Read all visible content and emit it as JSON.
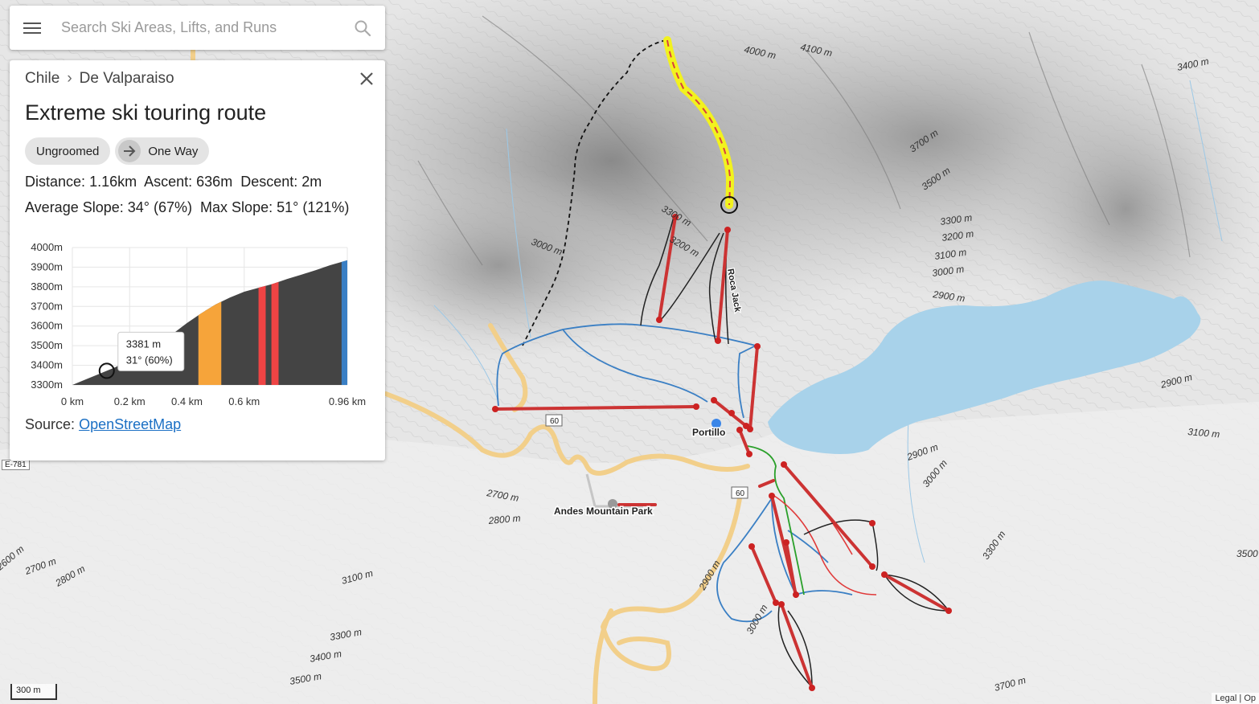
{
  "search": {
    "placeholder": "Search Ski Areas, Lifts, and Runs"
  },
  "icons": {
    "menu": "hamburger-menu-icon",
    "search": "search-icon",
    "close": "close-icon",
    "direction": "arrow-right-icon"
  },
  "panel": {
    "breadcrumb": [
      "Chile",
      "De Valparaiso"
    ],
    "breadcrumb_separator": "›",
    "title": "Extreme ski touring route",
    "badges": {
      "grooming": "Ungroomed",
      "direction": "One Way"
    },
    "stats": {
      "distance_label": "Distance:",
      "distance": "1.16km",
      "ascent_label": "Ascent:",
      "ascent": "636m",
      "descent_label": "Descent:",
      "descent": "2m",
      "avg_slope_label": "Average Slope:",
      "avg_slope": "34° (67%)",
      "max_slope_label": "Max Slope:",
      "max_slope": "51° (121%)"
    },
    "source_label": "Source:",
    "source_link": "OpenStreetMap"
  },
  "chart_data": {
    "type": "area",
    "title": "",
    "xlabel": "",
    "ylabel": "",
    "x_ticks": [
      "0 km",
      "0.2 km",
      "0.4 km",
      "0.6 km",
      "0.96 km"
    ],
    "x_tick_values": [
      0,
      0.2,
      0.4,
      0.6,
      0.96
    ],
    "y_ticks": [
      "3300m",
      "3400m",
      "3500m",
      "3600m",
      "3700m",
      "3800m",
      "3900m",
      "4000m"
    ],
    "y_tick_values": [
      3300,
      3400,
      3500,
      3600,
      3700,
      3800,
      3900,
      4000
    ],
    "xlim": [
      0,
      0.96
    ],
    "ylim": [
      3300,
      4000
    ],
    "x": [
      0,
      0.05,
      0.1,
      0.15,
      0.2,
      0.25,
      0.3,
      0.35,
      0.4,
      0.45,
      0.5,
      0.55,
      0.6,
      0.65,
      0.7,
      0.75,
      0.8,
      0.85,
      0.9,
      0.96
    ],
    "y": [
      3300,
      3330,
      3360,
      3390,
      3430,
      3470,
      3515,
      3560,
      3615,
      3665,
      3710,
      3745,
      3775,
      3795,
      3815,
      3840,
      3862,
      3885,
      3910,
      3935
    ],
    "fill_color": "#444444",
    "highlights": [
      {
        "from": 0.44,
        "to": 0.52,
        "color": "#f6a43a"
      },
      {
        "from": 0.65,
        "to": 0.675,
        "color": "#ee4444"
      },
      {
        "from": 0.695,
        "to": 0.72,
        "color": "#ee4444"
      },
      {
        "from": 0.94,
        "to": 0.96,
        "color": "#3a7fc4"
      }
    ],
    "tooltip": {
      "x": 0.12,
      "elevation": "3381 m",
      "slope": "31° (60%)"
    }
  },
  "map": {
    "contour_labels": [
      "4000 m",
      "4100 m",
      "3400 m",
      "3700 m",
      "3500 m",
      "3300 m",
      "3200 m",
      "3100 m",
      "3000 m",
      "2900 m",
      "3300 m",
      "3200 m",
      "3000 m",
      "2900 m",
      "3100 m",
      "2900 m",
      "3000 m",
      "3300 m",
      "3500",
      "2700 m",
      "2800 m",
      "2900 m",
      "3000 m",
      "3100 m",
      "3300 m",
      "3400 m",
      "3500 m",
      "3700 m",
      "2700 m",
      "2800 m",
      "2600 m"
    ],
    "places": {
      "portillo": "Portillo",
      "andes_park": "Andes Mountain Park"
    },
    "lift_label": "Roca Jack",
    "road_shields": [
      "60",
      "60"
    ],
    "road_e781": "E-781",
    "lake_color": "#a8d2ea",
    "route_highlight_color": "#f2f21e",
    "lift_color": "#cc3333",
    "advanced_run_color": "#e03a3a",
    "intermediate_run_color": "#3a7fc4",
    "easy_run_color": "#2aa02a",
    "expert_run_color": "#222222"
  },
  "scale": {
    "label": "300 m"
  },
  "attribution": "Legal | Op"
}
